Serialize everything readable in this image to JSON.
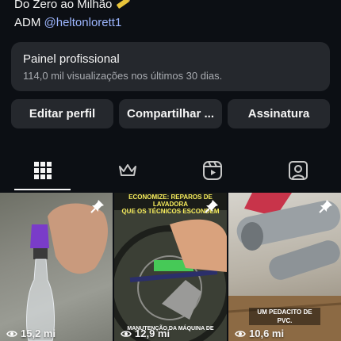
{
  "bio": {
    "line1": "Do Zero ao Milhão",
    "line2_prefix": "ADM",
    "handle": "@heltonlorett1"
  },
  "panel": {
    "title": "Painel profissional",
    "subtitle": "114,0 mil visualizações nos últimos 30 dias."
  },
  "buttons": {
    "edit": "Editar perfil",
    "share": "Compartilhar ...",
    "subscription": "Assinatura"
  },
  "tabs": [
    {
      "icon": "grid-icon",
      "active": true
    },
    {
      "icon": "crown-icon",
      "active": false
    },
    {
      "icon": "reels-icon",
      "active": false
    },
    {
      "icon": "tagged-icon",
      "active": false
    }
  ],
  "posts": [
    {
      "views": "15,2 mi",
      "pinned": true
    },
    {
      "views": "12,9 mi",
      "pinned": true,
      "caption_top_1": "ECONOMIZE: REPAROS DE LAVADORA",
      "caption_top_2": "QUE OS TÉCNICOS ESCONDEM",
      "caption_bottom": "MANUTENÇÃO DA MÁQUINA DE"
    },
    {
      "views": "10,6 mi",
      "pinned": true,
      "caption": "UM PEDACITO DE PVC."
    }
  ],
  "colors": {
    "background": "#0c0f14",
    "card": "#25282d",
    "link": "#9db6ff",
    "caption_yellow": "#f6ec5c"
  }
}
